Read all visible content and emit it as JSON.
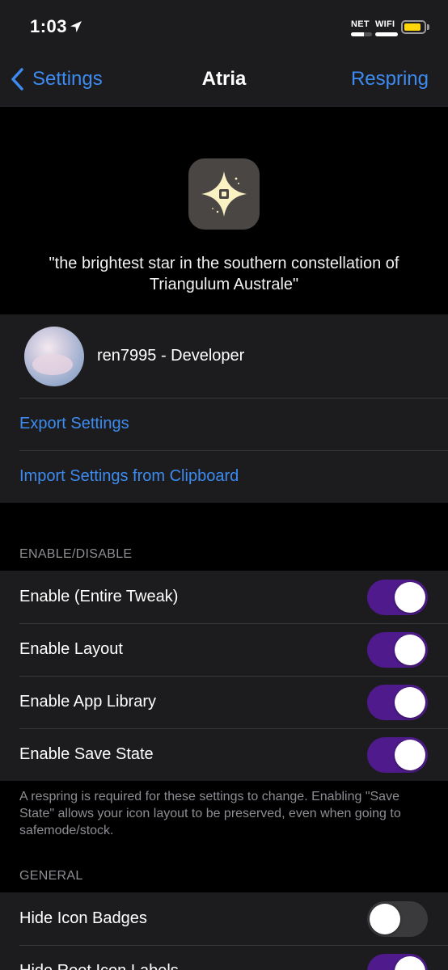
{
  "status_bar": {
    "time": "1:03",
    "network_label": "NET",
    "wifi_label": "WIFI",
    "network_level": 0.6,
    "wifi_level": 1.0,
    "battery_level": 0.85,
    "battery_color": "#ffd60a"
  },
  "nav": {
    "back_label": "Settings",
    "title": "Atria",
    "action_label": "Respring",
    "accent_color": "#3d8bf0"
  },
  "header": {
    "icon": "four-point-star-icon",
    "quote": "\"the brightest star in the southern constellation of Triangulum Australe\""
  },
  "developer": {
    "name": "ren7995 - Developer"
  },
  "links": {
    "export": "Export Settings",
    "import": "Import Settings from Clipboard"
  },
  "enable_section": {
    "header": "ENABLE/DISABLE",
    "items": [
      {
        "label": "Enable (Entire Tweak)",
        "on": true
      },
      {
        "label": "Enable Layout",
        "on": true
      },
      {
        "label": "Enable App Library",
        "on": true
      },
      {
        "label": "Enable Save State",
        "on": true
      }
    ],
    "footer": "A respring is required for these settings to change. Enabling \"Save State\" allows your icon layout to be preserved, even when going to safemode/stock."
  },
  "general_section": {
    "header": "GENERAL",
    "items": [
      {
        "label": "Hide Icon Badges",
        "on": false
      },
      {
        "label": "Hide Root Icon Labels",
        "on": true
      }
    ]
  },
  "toggle_on_color": "#4f1b8c"
}
